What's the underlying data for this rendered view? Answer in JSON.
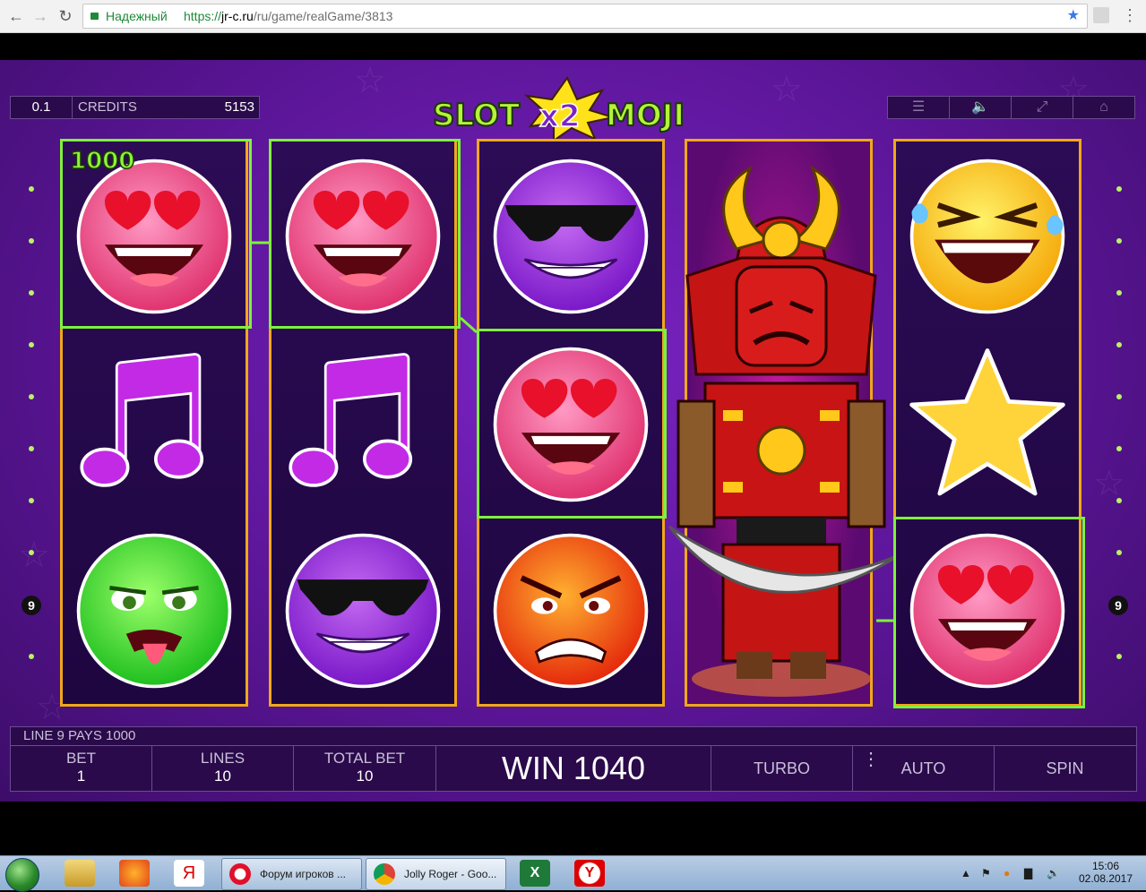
{
  "browser": {
    "secure_label": "Надежный",
    "url_scheme": "https://",
    "url_host": "jr-c.ru",
    "url_path": "/ru/game/realGame/3813"
  },
  "game": {
    "logo_text_left": "SLOT",
    "logo_text_x2": "x2",
    "logo_text_right": "MOJI",
    "denomination": "0.1",
    "credits_label": "CREDITS",
    "credits_value": "5153",
    "win_symbol_amount": "1000",
    "left_line_badge": "9",
    "right_line_badge": "9",
    "message": "LINE 9 PAYS 1000",
    "bet_label": "BET",
    "bet_value": "1",
    "lines_label": "LINES",
    "lines_value": "10",
    "total_bet_label": "TOTAL BET",
    "total_bet_value": "10",
    "win_text": "WIN 1040",
    "turbo_label": "TURBO",
    "auto_label": "AUTO",
    "spin_label": "SPIN",
    "reels": [
      [
        "heart-eyes-emoji",
        "music-note",
        "sick-emoji"
      ],
      [
        "heart-eyes-emoji",
        "music-note",
        "sunglasses-emoji"
      ],
      [
        "sunglasses-emoji",
        "heart-eyes-emoji",
        "angry-emoji"
      ],
      [
        "samurai-wild",
        "samurai-wild",
        "samurai-wild"
      ],
      [
        "laughing-emoji",
        "star",
        "heart-eyes-emoji"
      ]
    ],
    "colors": {
      "reel_border": "#f0a818",
      "win_line": "#7df23a",
      "bg": "#5b1597"
    }
  },
  "taskbar": {
    "tasks": [
      {
        "label": "Форум игроков ..."
      },
      {
        "label": "Jolly Roger - Goo..."
      }
    ],
    "time": "15:06",
    "date": "02.08.2017"
  }
}
